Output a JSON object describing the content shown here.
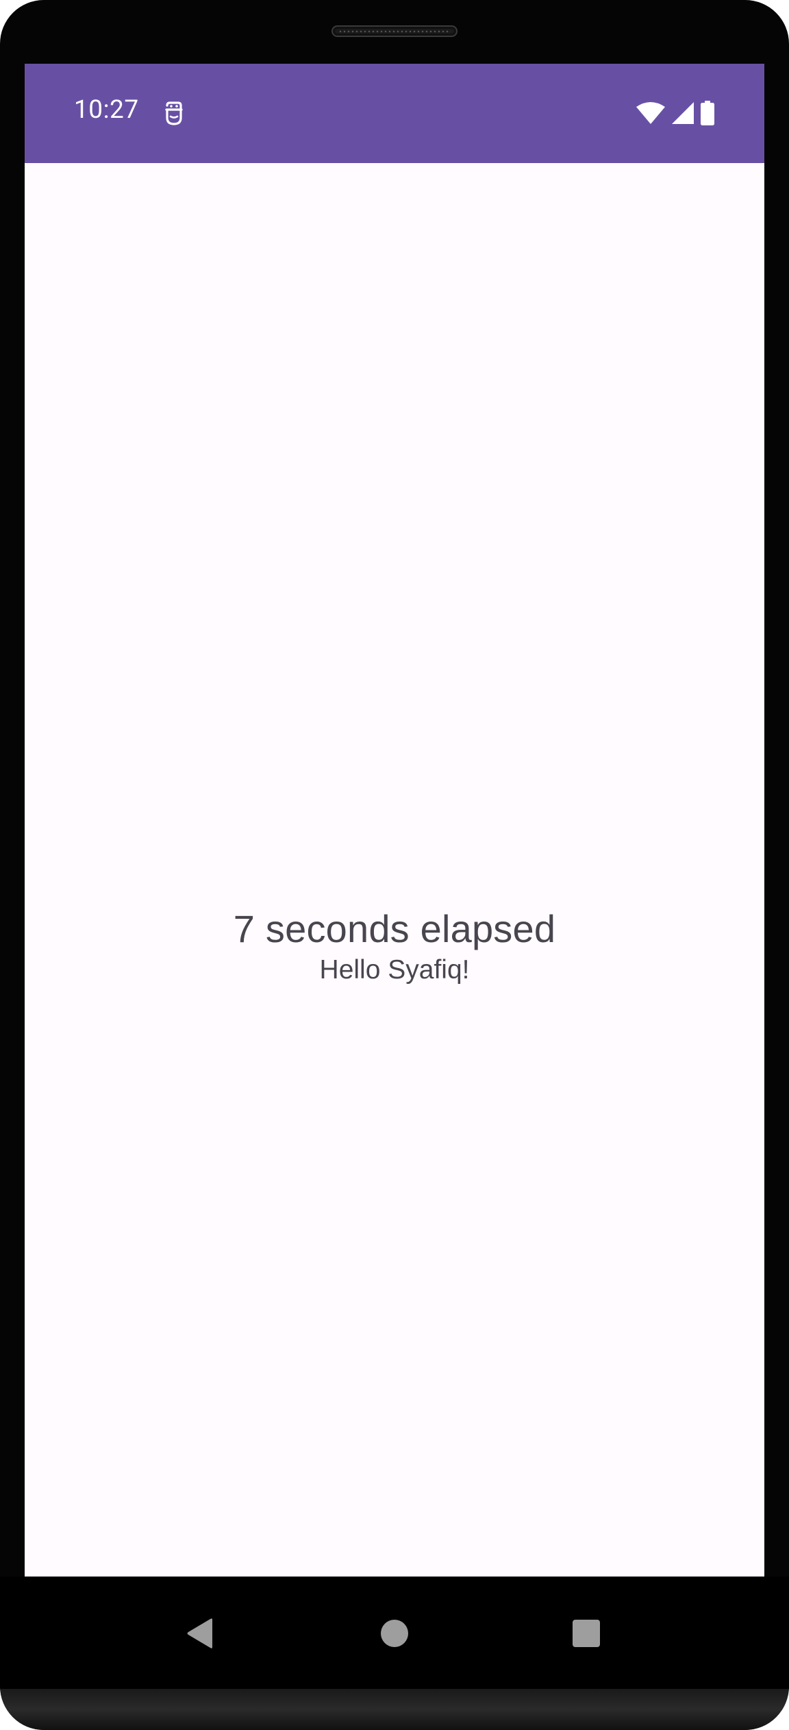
{
  "status_bar": {
    "time": "10:27",
    "background": "#6750a4",
    "icons": [
      "notification-icon",
      "wifi-icon",
      "cellular-signal-icon",
      "battery-icon"
    ]
  },
  "main": {
    "elapsed_text": "7 seconds elapsed",
    "greeting_text": "Hello Syafiq!",
    "text_color": "#49454f",
    "background": "#fffbfe"
  },
  "nav_bar": {
    "buttons": [
      "back-icon",
      "home-icon",
      "recents-icon"
    ]
  }
}
